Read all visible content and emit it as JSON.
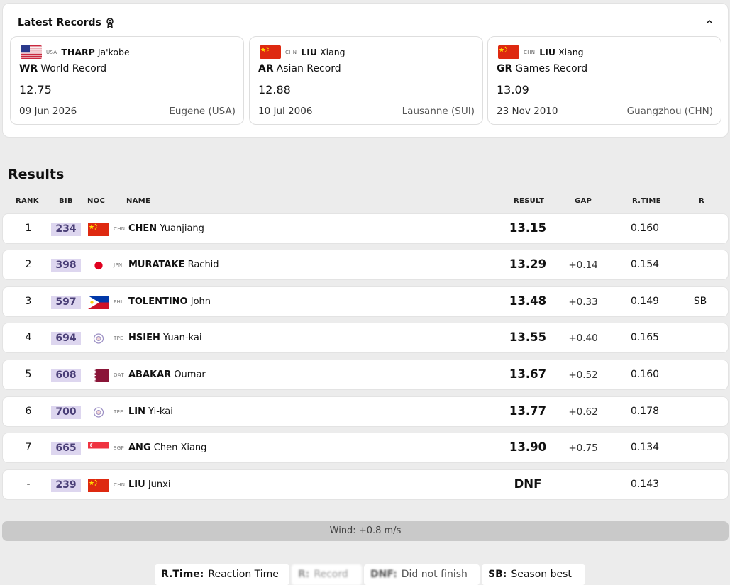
{
  "latest_records": {
    "title": "Latest Records",
    "cards": [
      {
        "noc": "USA",
        "surname": "THARP",
        "given": "Ja'kobe",
        "code": "WR",
        "label": "World Record",
        "time": "12.75",
        "date": "09 Jun 2026",
        "location": "Eugene (USA)",
        "flag": "usa"
      },
      {
        "noc": "CHN",
        "surname": "LIU",
        "given": "Xiang",
        "code": "AR",
        "label": "Asian Record",
        "time": "12.88",
        "date": "10 Jul 2006",
        "location": "Lausanne (SUI)",
        "flag": "chn"
      },
      {
        "noc": "CHN",
        "surname": "LIU",
        "given": "Xiang",
        "code": "GR",
        "label": "Games Record",
        "time": "13.09",
        "date": "23 Nov 2010",
        "location": "Guangzhou (CHN)",
        "flag": "chn"
      }
    ]
  },
  "results": {
    "title": "Results",
    "headers": {
      "rank": "RANK",
      "bib": "BIB",
      "noc": "NOC",
      "name": "NAME",
      "result": "RESULT",
      "gap": "GAP",
      "rtime": "R.TIME",
      "r": "R"
    },
    "rows": [
      {
        "rank": "1",
        "bib": "234",
        "noc": "CHN",
        "surname": "CHEN",
        "given": "Yuanjiang",
        "result": "13.15",
        "gap": "",
        "rtime": "0.160",
        "rec": "",
        "flag": "chn"
      },
      {
        "rank": "2",
        "bib": "398",
        "noc": "JPN",
        "surname": "MURATAKE",
        "given": "Rachid",
        "result": "13.29",
        "gap": "+0.14",
        "rtime": "0.154",
        "rec": "",
        "flag": "jpn"
      },
      {
        "rank": "3",
        "bib": "597",
        "noc": "PHI",
        "surname": "TOLENTINO",
        "given": "John",
        "result": "13.48",
        "gap": "+0.33",
        "rtime": "0.149",
        "rec": "SB",
        "flag": "phi"
      },
      {
        "rank": "4",
        "bib": "694",
        "noc": "TPE",
        "surname": "HSIEH",
        "given": "Yuan-kai",
        "result": "13.55",
        "gap": "+0.40",
        "rtime": "0.165",
        "rec": "",
        "flag": "tpe"
      },
      {
        "rank": "5",
        "bib": "608",
        "noc": "QAT",
        "surname": "ABAKAR",
        "given": "Oumar",
        "result": "13.67",
        "gap": "+0.52",
        "rtime": "0.160",
        "rec": "",
        "flag": "qat"
      },
      {
        "rank": "6",
        "bib": "700",
        "noc": "TPE",
        "surname": "LIN",
        "given": "Yi-kai",
        "result": "13.77",
        "gap": "+0.62",
        "rtime": "0.178",
        "rec": "",
        "flag": "tpe"
      },
      {
        "rank": "7",
        "bib": "665",
        "noc": "SGP",
        "surname": "ANG",
        "given": "Chen Xiang",
        "result": "13.90",
        "gap": "+0.75",
        "rtime": "0.134",
        "rec": "",
        "flag": "sgp"
      },
      {
        "rank": "-",
        "bib": "239",
        "noc": "CHN",
        "surname": "LIU",
        "given": "Junxi",
        "result": "DNF",
        "gap": "",
        "rtime": "0.143",
        "rec": "",
        "flag": "chn"
      }
    ]
  },
  "wind": "Wind: +0.8 m/s",
  "legend": [
    {
      "key": "R.Time:",
      "value": "Reaction Time"
    },
    {
      "key": "R:",
      "value": "Record"
    },
    {
      "key": "DNF:",
      "value": "Did not finish"
    },
    {
      "key": "SB:",
      "value": "Season best"
    }
  ],
  "icons": {
    "award": "award-ribbon-icon",
    "collapse": "chevron-up-icon"
  },
  "colors": {
    "bib_bg": "#ddd6ef",
    "bib_text": "#4a3f77",
    "panel_bg": "#ffffff",
    "page_bg": "#ececec",
    "wind_bg": "#c9c9c9"
  }
}
